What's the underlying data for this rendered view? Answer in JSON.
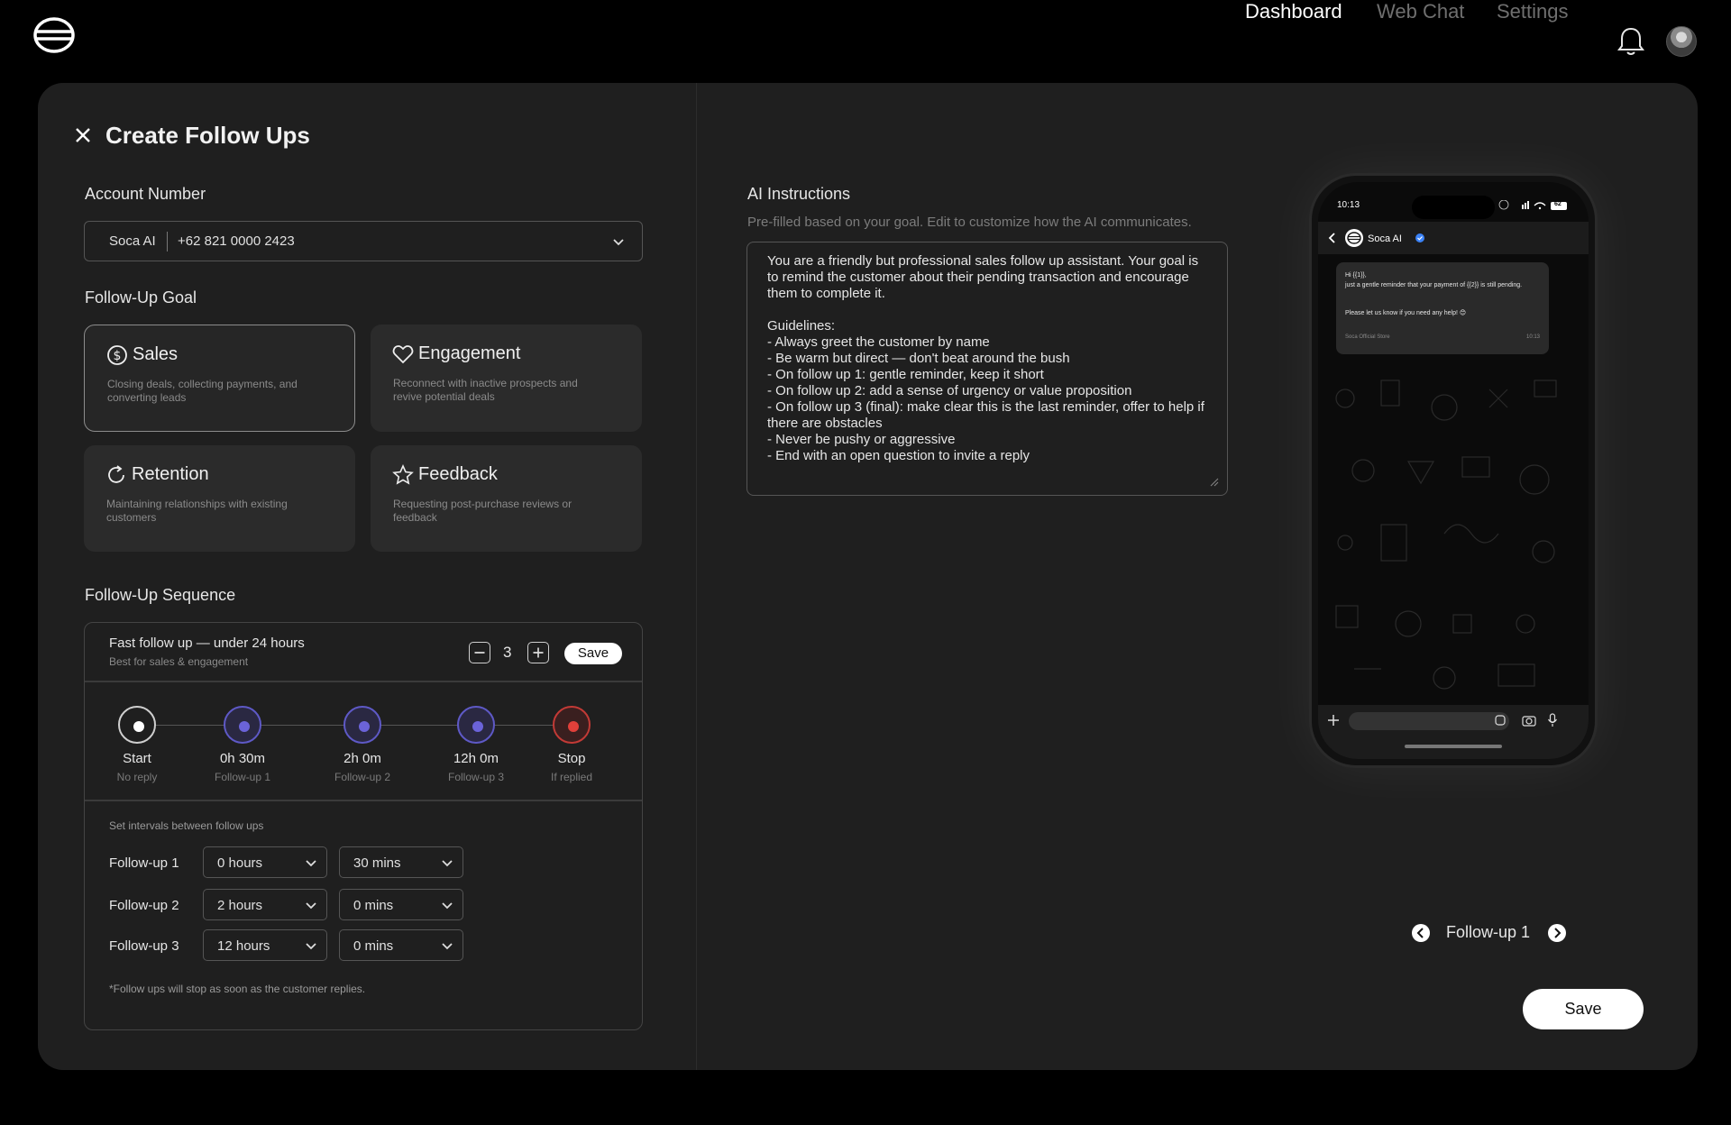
{
  "nav": {
    "links": [
      "Dashboard",
      "Web Chat",
      "Settings"
    ],
    "active": "Dashboard"
  },
  "page": {
    "title": "Create Follow Ups"
  },
  "account": {
    "label": "Account Number",
    "name": "Soca AI",
    "number": "+62 821 0000 2423"
  },
  "goal": {
    "label": "Follow-Up Goal",
    "options": [
      {
        "title": "Sales",
        "desc": "Closing deals, collecting payments, and converting leads",
        "icon": "dollar-icon",
        "selected": true
      },
      {
        "title": "Engagement",
        "desc": "Reconnect with inactive prospects and revive potential deals",
        "icon": "heart-icon",
        "selected": false
      },
      {
        "title": "Retention",
        "desc": "Maintaining relationships with existing customers",
        "icon": "refresh-icon",
        "selected": false
      },
      {
        "title": "Feedback",
        "desc": "Requesting post-purchase reviews or feedback",
        "icon": "star-icon",
        "selected": false
      }
    ]
  },
  "sequence": {
    "label": "Follow-Up Sequence",
    "preset_title": "Fast follow up — under 24 hours",
    "preset_sub": "Best for sales & engagement",
    "count": "3",
    "save_label": "Save",
    "timeline": [
      {
        "time": "Start",
        "sub": "No reply"
      },
      {
        "time": "0h 30m",
        "sub": "Follow-up 1"
      },
      {
        "time": "2h 0m",
        "sub": "Follow-up 2"
      },
      {
        "time": "12h 0m",
        "sub": "Follow-up 3"
      },
      {
        "time": "Stop",
        "sub": "If replied"
      }
    ],
    "interval_caption": "Set intervals between follow ups",
    "intervals": [
      {
        "label": "Follow-up 1",
        "hours": "0 hours",
        "mins": "30 mins"
      },
      {
        "label": "Follow-up 2",
        "hours": "2 hours",
        "mins": "0 mins"
      },
      {
        "label": "Follow-up 3",
        "hours": "12 hours",
        "mins": "0 mins"
      }
    ],
    "footnote": "*Follow ups will stop as soon as the customer replies."
  },
  "ai": {
    "label": "AI Instructions",
    "sub": "Pre-filled based on your goal. Edit to customize how the AI communicates.",
    "text": "You are a friendly but professional sales follow up assistant. Your goal is to remind the customer about their pending transaction and encourage them to complete it.\n\nGuidelines:\n- Always greet the customer by name\n- Be warm but direct — don't beat around the bush\n- On follow up 1: gentle reminder, keep it short\n- On follow up 2: add a sense of urgency or value proposition\n- On follow up 3 (final): make clear this is the last reminder, offer to help if there are obstacles\n- Never be pushy or aggressive\n- End with an open question to invite a reply"
  },
  "preview": {
    "status_time": "10:13",
    "battery": "62",
    "chat_name": "Soca AI",
    "message_line1": "Hi {{1}},",
    "message_line2": "just a gentle reminder that your payment of {{2}} is still pending.",
    "message_line3": "Please let us know if you need any help! 😊",
    "message_sender": "Soca Official Store",
    "message_time": "10:13",
    "nav_label": "Follow-up 1"
  },
  "footer": {
    "save_label": "Save"
  },
  "colors": {
    "accent": "#6b63d9",
    "stop": "#e0403a",
    "panel": "#1f1f1f"
  }
}
